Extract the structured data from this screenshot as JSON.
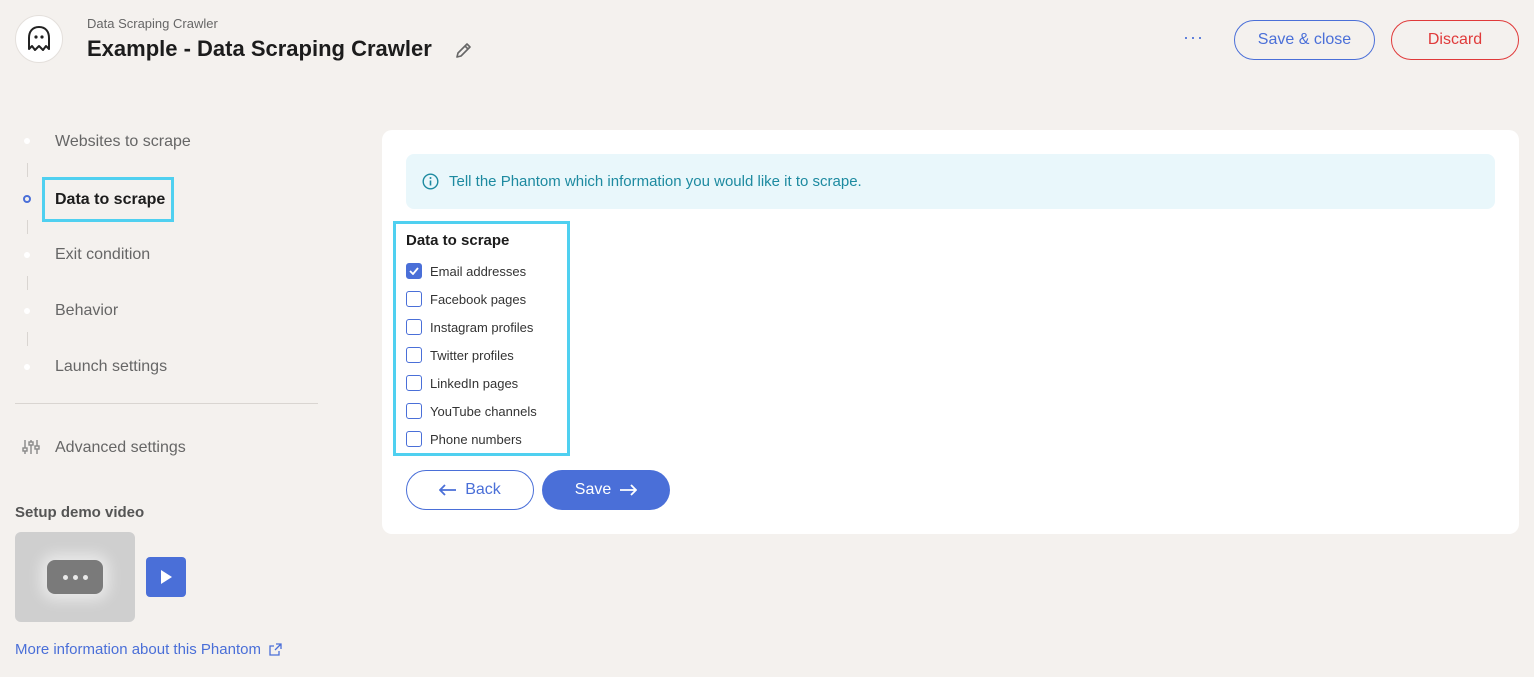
{
  "header": {
    "subtitle": "Data Scraping Crawler",
    "title": "Example - Data Scraping Crawler",
    "more_label": "···",
    "save_close_label": "Save & close",
    "discard_label": "Discard"
  },
  "sidebar": {
    "steps": [
      {
        "label": "Websites to scrape"
      },
      {
        "label": "Data to scrape",
        "active": true
      },
      {
        "label": "Exit condition"
      },
      {
        "label": "Behavior"
      },
      {
        "label": "Launch settings"
      }
    ],
    "advanced_label": "Advanced settings",
    "demo_title": "Setup demo video",
    "more_info_label": "More information about this Phantom"
  },
  "main": {
    "info_text": "Tell the Phantom which information you would like it to scrape.",
    "field_title": "Data to scrape",
    "options": [
      {
        "label": "Email addresses",
        "checked": true
      },
      {
        "label": "Facebook pages",
        "checked": false
      },
      {
        "label": "Instagram profiles",
        "checked": false
      },
      {
        "label": "Twitter profiles",
        "checked": false
      },
      {
        "label": "LinkedIn pages",
        "checked": false
      },
      {
        "label": "YouTube channels",
        "checked": false
      },
      {
        "label": "Phone numbers",
        "checked": false
      }
    ],
    "back_label": "Back",
    "save_label": "Save"
  },
  "colors": {
    "accent": "#4a6fd8",
    "danger": "#e03a3a",
    "highlight": "#4fd0f0",
    "info_bg": "#e9f7fb",
    "info_text": "#1d8aa0"
  }
}
